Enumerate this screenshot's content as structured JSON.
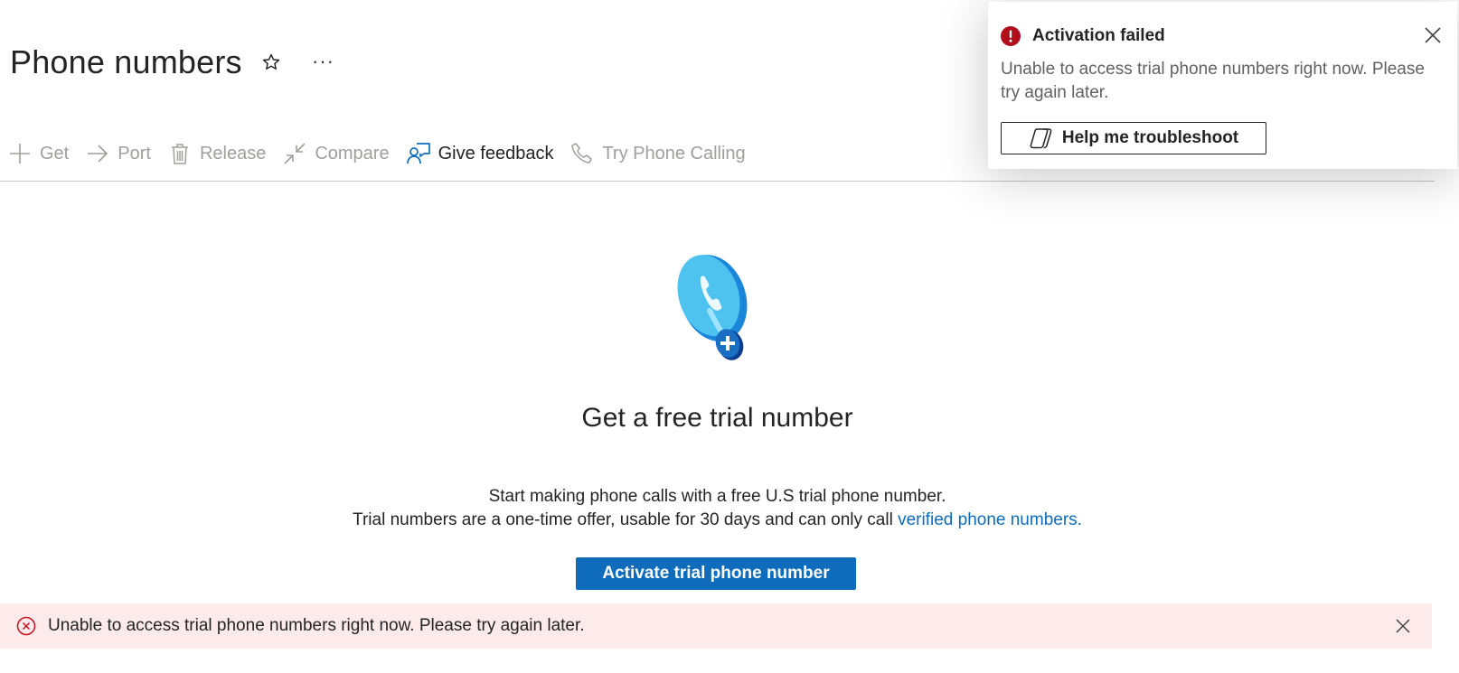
{
  "header": {
    "title": "Phone numbers",
    "favorite_icon": "star-outline-icon",
    "more_label": "···"
  },
  "toolbar": {
    "items": [
      {
        "label": "Get",
        "icon": "plus-icon",
        "enabled": false
      },
      {
        "label": "Port",
        "icon": "arrow-right-icon",
        "enabled": false
      },
      {
        "label": "Release",
        "icon": "trash-icon",
        "enabled": false
      },
      {
        "label": "Compare",
        "icon": "compare-arrows-icon",
        "enabled": false
      },
      {
        "label": "Give feedback",
        "icon": "feedback-person-icon",
        "enabled": true
      },
      {
        "label": "Try Phone Calling",
        "icon": "phone-icon",
        "enabled": false
      }
    ]
  },
  "empty_state": {
    "illustration": "phone-add-illustration",
    "title": "Get a free trial number",
    "line1": "Start making phone calls with a free U.S trial phone number.",
    "line2_prefix": "Trial numbers are a one-time offer, usable for 30 days and can only call ",
    "line2_link": "verified phone numbers.",
    "activate_button": "Activate trial phone number"
  },
  "error_bar": {
    "icon": "error-circle-icon",
    "message": "Unable to access trial phone numbers right now. Please try again later.",
    "close_icon": "close-icon"
  },
  "toast": {
    "icon": "error-badge-icon",
    "title": "Activation failed",
    "message": "Unable to access trial phone numbers right now. Please try again later.",
    "button_label": "Help me troubleshoot",
    "button_icon": "copilot-icon",
    "close_icon": "close-icon"
  },
  "colors": {
    "accent": "#0f6cbd",
    "error": "#c50f1f",
    "error_background": "#fdeaea",
    "disabled_text": "#a19f9d"
  }
}
